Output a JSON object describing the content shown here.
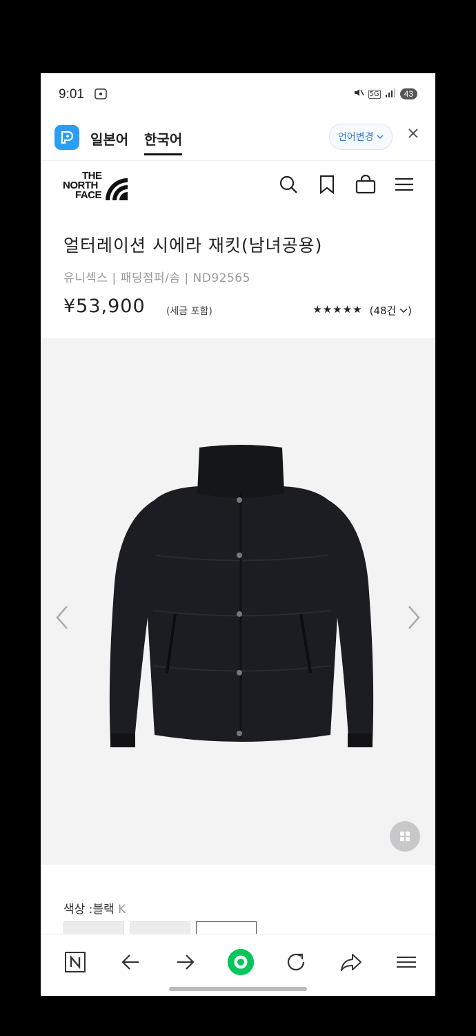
{
  "status_bar": {
    "time": "9:01",
    "network": "5G",
    "battery": "43"
  },
  "translate_bar": {
    "source_lang": "일본어",
    "target_lang": "한국어",
    "change_label": "언어변경",
    "close_icon": "close-icon"
  },
  "brand": {
    "logo_lines": [
      "THE",
      "NORTH",
      "FACE"
    ],
    "icons": [
      "search-icon",
      "bookmark-icon",
      "bag-icon",
      "menu-icon"
    ]
  },
  "product": {
    "title": "얼터레이션 시에라 재킷(남녀공용)",
    "subtitle": "유니섹스 | 패딩점퍼/솜 | ND92565",
    "price": "¥53,900",
    "tax_note": "(세금 포함)",
    "stars": "★★★★★",
    "review_count": "(48건",
    "rating_value": 5
  },
  "gallery": {
    "prev_icon": "chevron-left-icon",
    "next_icon": "chevron-right-icon",
    "grid_icon": "grid-icon"
  },
  "color": {
    "label": "색상 :블랙",
    "code": "K"
  },
  "bottom_nav": {
    "items": [
      "naver-home-icon",
      "back-arrow-icon",
      "forward-arrow-icon",
      "green-dot-icon",
      "refresh-icon",
      "share-icon",
      "menu-icon"
    ]
  },
  "colors": {
    "accent": "#2a9df4",
    "green": "#03c75a",
    "image_bg": "#f3f3f4"
  }
}
